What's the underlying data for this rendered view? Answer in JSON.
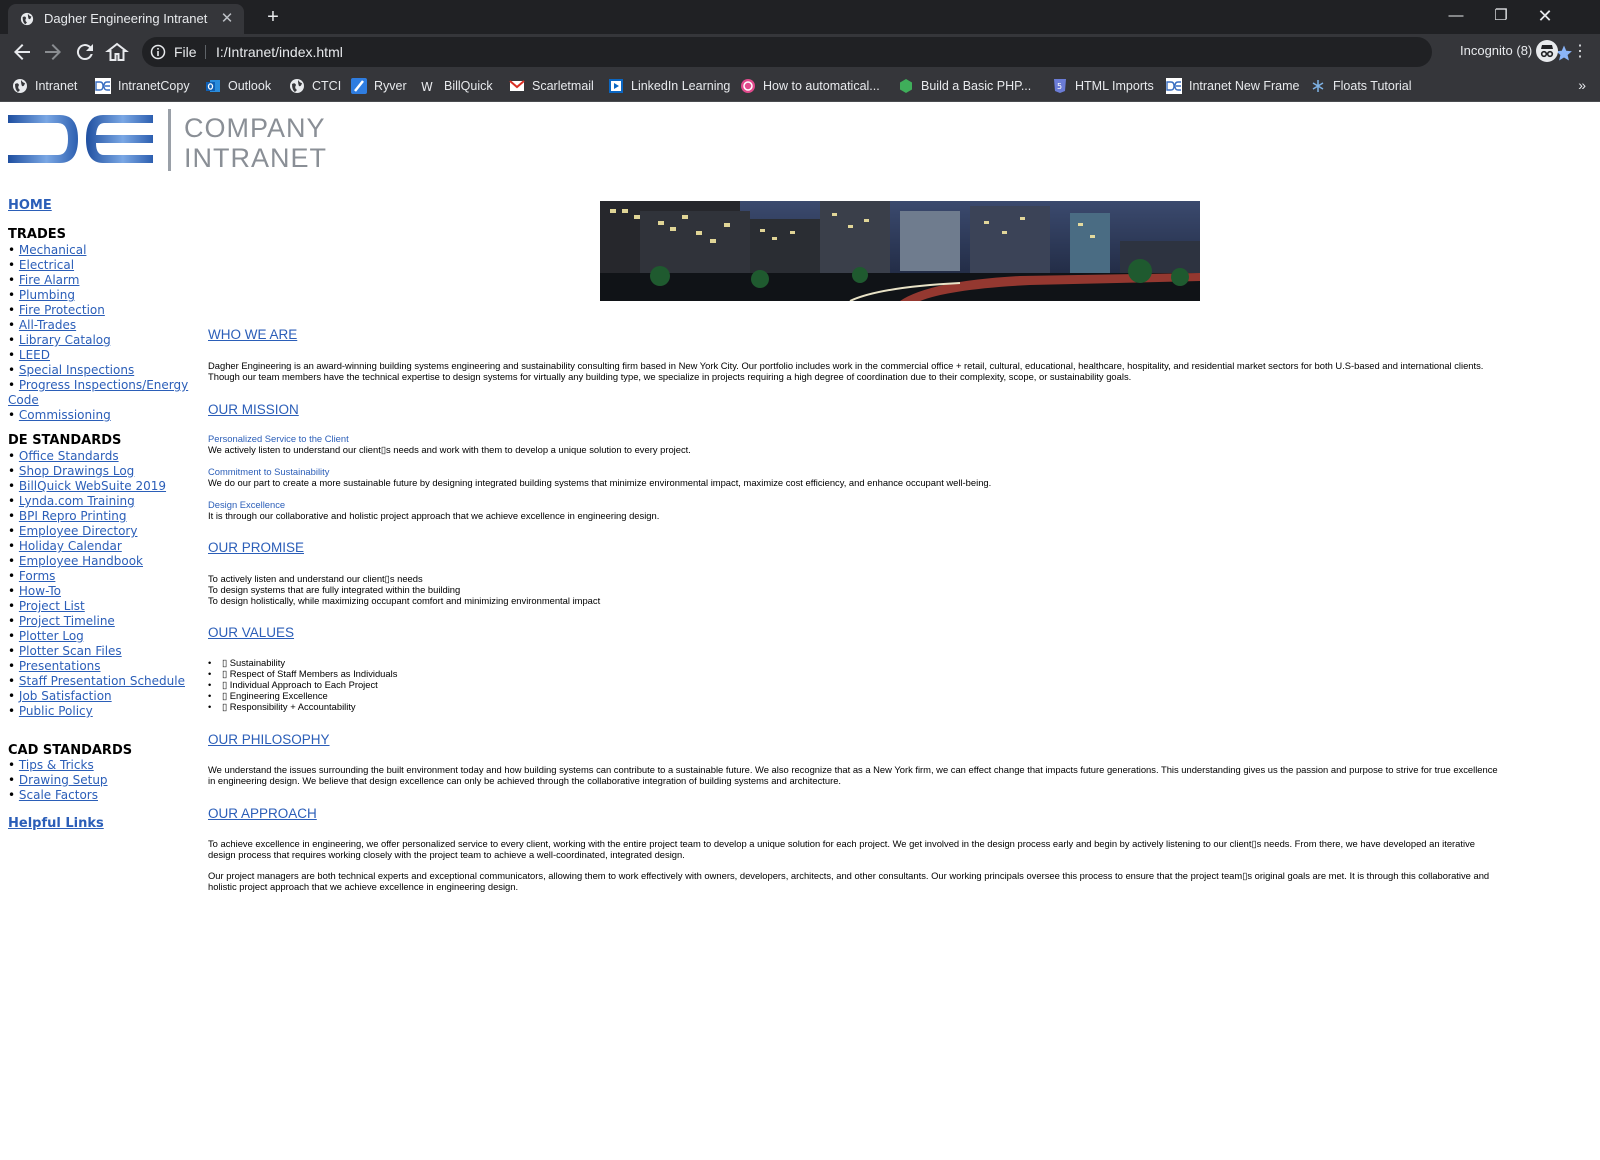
{
  "browser": {
    "tab_title": "Dagher Engineering Intranet",
    "omnibox_scheme": "File",
    "url": "I:/Intranet/index.html",
    "incognito_label": "Incognito (8)",
    "bookmarks": [
      {
        "label": "Intranet",
        "icon": "globe-icon"
      },
      {
        "label": "IntranetCopy",
        "icon": "de-logo-icon"
      },
      {
        "label": "Outlook",
        "icon": "outlook-icon"
      },
      {
        "label": "CTCI",
        "icon": "globe-icon"
      },
      {
        "label": "Ryver",
        "icon": "ryver-icon"
      },
      {
        "label": "BillQuick",
        "icon": "billquick-icon"
      },
      {
        "label": "Scarletmail",
        "icon": "gmail-icon"
      },
      {
        "label": "LinkedIn Learning",
        "icon": "linkedin-learning-icon"
      },
      {
        "label": "How to automatical...",
        "icon": "spiral-icon"
      },
      {
        "label": "Build a Basic PHP...",
        "icon": "hexagon-icon"
      },
      {
        "label": "HTML Imports",
        "icon": "html5-icon"
      },
      {
        "label": "Intranet New Frame",
        "icon": "de-logo-icon"
      },
      {
        "label": "Floats Tutorial",
        "icon": "floats-icon"
      }
    ]
  },
  "logo": {
    "line1": "COMPANY",
    "line2": "INTRANET",
    "mark": "DE"
  },
  "sidebar": {
    "home": "HOME",
    "trades_heading": "TRADES",
    "trades": [
      "Mechanical",
      "Electrical",
      "Fire Alarm",
      "Plumbing",
      "Fire Protection",
      "All-Trades",
      "Library Catalog",
      "LEED",
      "Special Inspections",
      "Progress Inspections/Energy Code",
      "Commissioning"
    ],
    "de_heading": "DE STANDARDS",
    "de_standards": [
      "Office Standards",
      "Shop Drawings Log",
      "BillQuick WebSuite 2019",
      "Lynda.com Training",
      "BPI Repro Printing",
      "Employee Directory",
      "Holiday Calendar",
      "Employee Handbook",
      "Forms",
      "How-To",
      "Project List",
      "Project Timeline",
      "Plotter Log",
      "Plotter Scan Files",
      "Presentations",
      "Staff Presentation Schedule",
      "Job Satisfaction",
      "Public Policy"
    ],
    "cad_heading": "CAD STANDARDS",
    "cad_standards": [
      "Tips & Tricks",
      "Drawing Setup",
      "Scale Factors"
    ],
    "helpful": "Helpful Links"
  },
  "main": {
    "who_title": "WHO WE ARE",
    "who_p1": "Dagher Engineering is an award-winning building systems engineering and sustainability consulting firm based in New York City. Our portfolio includes work in the commercial office + retail, cultural, educational, healthcare, hospitality, and residential market sectors for both U.S-based and international clients.",
    "who_p2": "Though our team members have the technical expertise to design systems for virtually any building type, we specialize in projects requiring a high degree of coordination due to their complexity, scope, or sustainability goals.",
    "mission_title": "OUR MISSION",
    "mission_items": [
      {
        "title": "Personalized Service to the Client",
        "text": "We actively listen to understand our client▯s needs and work with them to develop a unique solution to every project."
      },
      {
        "title": "Commitment to Sustainability",
        "text": "We do our part to create a more sustainable future by designing integrated building systems that minimize environmental impact, maximize cost efficiency, and enhance occupant well-being."
      },
      {
        "title": "Design Excellence",
        "text": "It is through our collaborative and holistic project approach that we achieve excellence in engineering design."
      }
    ],
    "promise_title": "OUR PROMISE",
    "promise_lines": [
      "To actively listen and understand our client▯s needs",
      "To design systems that are fully integrated within the building",
      "To design holistically, while maximizing occupant comfort and minimizing environmental impact"
    ],
    "values_title": "OUR VALUES",
    "values": [
      "▯ Sustainability",
      "▯ Respect of Staff Members as Individuals",
      "▯ Individual Approach to Each Project",
      "▯ Engineering Excellence",
      "▯ Responsibility + Accountability"
    ],
    "philosophy_title": "OUR PHILOSOPHY",
    "philosophy_p1": "We understand the issues surrounding the built environment today and how building systems can contribute to a sustainable future. We also recognize that as a New York firm, we can effect change that impacts future generations. This understanding gives us the passion and purpose to strive for true excellence",
    "philosophy_p2": "in engineering design. We believe that design excellence can only be achieved through the collaborative integration of building systems and architecture.",
    "approach_title": "OUR APPROACH",
    "approach_p1a": "To achieve excellence in engineering, we offer personalized service to every client, working with the entire project team to develop a unique solution for each project. We get involved in the design process early and begin by actively listening to our client▯s needs. From there, we have developed an iterative",
    "approach_p1b": "design process that requires working closely with the project team to achieve a well-coordinated, integrated design.",
    "approach_p2a": "Our project managers are both technical experts and exceptional communicators, allowing them to work effectively with owners, developers, architects, and other consultants. Our working principals oversee this process to ensure that the project team▯s original goals are met. It is through this collaborative and",
    "approach_p2b": "holistic project approach that we achieve excellence in engineering design."
  },
  "colors": {
    "link": "#2b5eb8",
    "chrome_dark": "#202124",
    "chrome": "#35363a",
    "star": "#8ab4f8"
  }
}
